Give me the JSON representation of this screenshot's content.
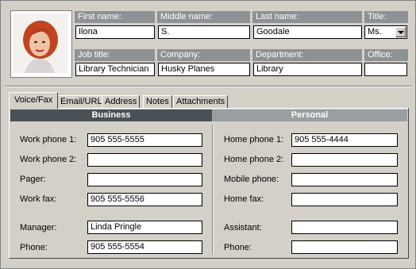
{
  "header": {
    "first_name": {
      "label": "First name:",
      "value": "Ilona"
    },
    "middle_name": {
      "label": "Middle name:",
      "value": "S."
    },
    "last_name": {
      "label": "Last name:",
      "value": "Goodale"
    },
    "title": {
      "label": "Title:",
      "value": "Ms."
    },
    "job_title": {
      "label": "Job title:",
      "value": "Library Technician"
    },
    "company": {
      "label": "Company:",
      "value": "Husky Planes"
    },
    "department": {
      "label": "Department:",
      "value": "Library"
    },
    "office": {
      "label": "Office:",
      "value": ""
    }
  },
  "tabs": [
    "Voice/Fax",
    "Email/URL",
    "Address",
    "Notes",
    "Attachments"
  ],
  "business": {
    "title": "Business",
    "work_phone_1": {
      "label": "Work phone 1:",
      "value": "905 555-5555"
    },
    "work_phone_2": {
      "label": "Work phone 2:",
      "value": ""
    },
    "pager": {
      "label": "Pager:",
      "value": ""
    },
    "work_fax": {
      "label": "Work fax:",
      "value": "905 555-5556"
    },
    "manager": {
      "label": "Manager:",
      "value": "Linda Pringle"
    },
    "phone": {
      "label": "Phone:",
      "value": "905 555-5554"
    }
  },
  "personal": {
    "title": "Personal",
    "home_phone_1": {
      "label": "Home phone 1:",
      "value": "905 555-4444"
    },
    "home_phone_2": {
      "label": "Home phone 2:",
      "value": ""
    },
    "mobile_phone": {
      "label": "Mobile phone:",
      "value": ""
    },
    "home_fax": {
      "label": "Home fax:",
      "value": ""
    },
    "assistant": {
      "label": "Assistant:",
      "value": ""
    },
    "phone": {
      "label": "Phone:",
      "value": ""
    }
  },
  "colors": {
    "header_bg": "#8e9296",
    "business_bar": "#4a5156",
    "personal_bar": "#9a9ea2",
    "window_bg": "#d4d0c8"
  },
  "icons": {
    "photo": "contact-photo",
    "dropdown": "chevron-down-icon"
  }
}
